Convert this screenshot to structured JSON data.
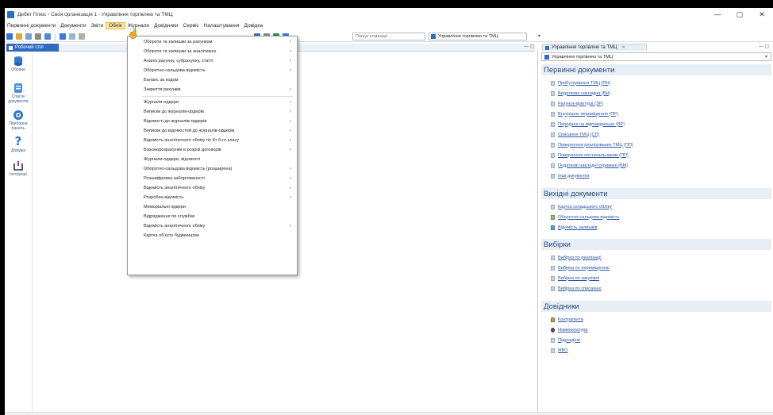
{
  "window": {
    "title": "Дебет Плюс - Своя организація 1 - Управління торгівлею та ТМЦ",
    "minimize_label": "—",
    "maximize_label": "▢",
    "close_label": "✕"
  },
  "menubar": {
    "items": [
      "Первинні документи",
      "Документи",
      "Звіти",
      "Облік",
      "Журнали",
      "Довідники",
      "Сервіс",
      "Налаштування",
      "Довідка"
    ]
  },
  "toolbar": {
    "command_placeholder": "Пошук команди",
    "open_document": "Управління торгівлею та ТМЦ"
  },
  "left_tab": {
    "label": "Робочий стіл"
  },
  "shortcuts": [
    {
      "label": "Обране"
    },
    {
      "label": "Список документів"
    },
    {
      "label": "Приборна панель"
    },
    {
      "label": "Довідка"
    },
    {
      "label": "Інструкції"
    }
  ],
  "dropdown": {
    "items": [
      {
        "label": "Обороти та залишки за рахунком",
        "submenu": true
      },
      {
        "label": "Обороти та залишки за аналітикою",
        "submenu": true
      },
      {
        "label": "Аналіз рахунку, субрахунку, статті",
        "submenu": true
      },
      {
        "label": "Оборотно-сальдова відомість",
        "submenu": true
      },
      {
        "label": "Баланс за кодом",
        "submenu": false
      },
      {
        "label": "Закриття рахунків",
        "submenu": true
      },
      {
        "label": "Журнали-ордери",
        "submenu": true
      },
      {
        "label": "Виписки до журналів-ордерів",
        "submenu": true
      },
      {
        "label": "Відомості до журналів-ордерів",
        "submenu": true
      },
      {
        "label": "Виписки до відомостей до журналів-ордерів",
        "submenu": true
      },
      {
        "label": "Відомість аналітичного обліку по Кт б-го класу",
        "submenu": true
      },
      {
        "label": "Взаєморозрахунки в розрізі договорів",
        "submenu": true
      },
      {
        "label": "Журнали-ордери, відомості",
        "submenu": false
      },
      {
        "label": "Оборотно-сальдова відомість (розширена)",
        "submenu": true
      },
      {
        "label": "Розшифровка заборгованості",
        "submenu": true
      },
      {
        "label": "Відомість аналітичного обліку",
        "submenu": true
      },
      {
        "label": "Розробна відомість",
        "submenu": true
      },
      {
        "label": "Меморіальні ордери",
        "submenu": false
      },
      {
        "label": "Відрядження по службах",
        "submenu": false
      },
      {
        "label": "Відомість аналітичного обліку",
        "submenu": true
      },
      {
        "label": "Картка об'єкту будівництва",
        "submenu": false
      }
    ],
    "submenu_arrow": "›"
  },
  "right_panel": {
    "tab_label": "Управління торгівлею та ТМЦ",
    "tab_close": "✕",
    "select_value": "Управління торгівлею та ТМЦ",
    "sections": [
      {
        "title": "Первинні документи",
        "links": [
          "Прибуткування ТМЦ (ПН)",
          "Видаткова накладна (ВН)",
          "Рахунок-фактура (ЗР)",
          "Внутрішнє переміщення (ПР)",
          "Передача на відповідальне (ВР)",
          "Списання ТМЦ (СП)",
          "Повернення реалізованих ТМЦ (ПП)",
          "Повернення постачальникам (ПП)",
          "Податкові накладні отримані (ВМ)",
          "Інші документи"
        ]
      },
      {
        "title": "Вихідні документи",
        "links": [
          "Картка складського обліку",
          "Оборотно-сальдова відомість",
          "Відомість залишків"
        ]
      },
      {
        "title": "Вибірки",
        "links": [
          "Вибірка по реалізації",
          "Вибірка по переміщенню",
          "Вибірка по закупівлі",
          "Вибірка по списанню"
        ]
      },
      {
        "title": "Довідники",
        "links": [
          "Контрагенти",
          "Номенклатура",
          "Підрозділи",
          "МВО"
        ]
      }
    ]
  },
  "colors": {
    "accent": "#2f6cbf",
    "section_bg": "#e8eef6",
    "section_text": "#274d80",
    "link": "#2b55a8",
    "menu_active": "#fbe9a0"
  }
}
